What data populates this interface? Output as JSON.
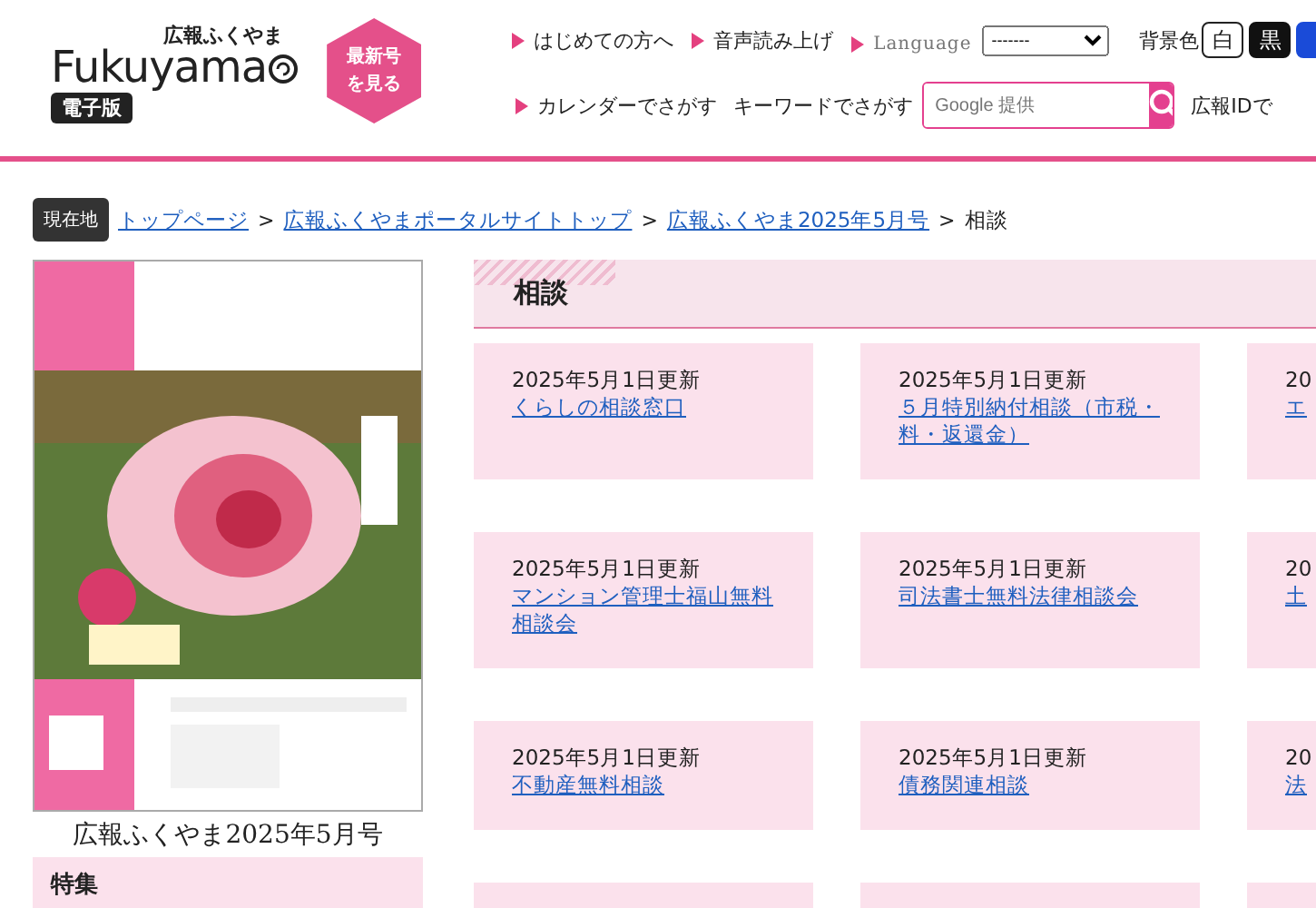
{
  "header": {
    "logo": {
      "title": "広報ふくやま",
      "wordmark": "Fukuyama",
      "badge": "電子版"
    },
    "latest_button": "最新号を見る",
    "links_row1": [
      "はじめての方へ",
      "音声読み上げ"
    ],
    "language": {
      "label": "Language",
      "value": "-------"
    },
    "background": {
      "label": "背景色",
      "options": [
        {
          "label": "白",
          "kind": "white"
        },
        {
          "label": "黒",
          "kind": "black"
        },
        {
          "kind": "blue"
        }
      ]
    },
    "links_row2": [
      "カレンダーでさがす"
    ],
    "search": {
      "label": "キーワードでさがす",
      "placeholder": "Google 提供"
    },
    "id_search": "広報IDで"
  },
  "breadcrumb": {
    "label": "現在地",
    "links": [
      {
        "label": "トップページ",
        "separator": ">"
      },
      {
        "label": "広報ふくやまポータルサイトトップ",
        "separator": ">"
      },
      {
        "label": "広報ふくやま2025年5月号",
        "separator": ">"
      }
    ],
    "current": "相談"
  },
  "sidebar": {
    "caption": "広報ふくやま2025年5月号",
    "section": "特集"
  },
  "main": {
    "heading": "相談",
    "cards": [
      {
        "kind": "article",
        "date": "2025年5月1日更新",
        "title": "くらしの相談窓口"
      },
      {
        "kind": "article",
        "date": "2025年5月1日更新",
        "title": "５月特別納付相談（市税・料・返還金）"
      },
      {
        "kind": "article",
        "date": "20",
        "title": "エ"
      },
      {
        "kind": "article",
        "date": "2025年5月1日更新",
        "title": "マンション管理士福山無料相談会"
      },
      {
        "kind": "article",
        "date": "2025年5月1日更新",
        "title": "司法書士無料法律相談会"
      },
      {
        "kind": "article",
        "date": "20",
        "title": "土"
      },
      {
        "kind": "article",
        "date": "2025年5月1日更新",
        "title": "不動産無料相談"
      },
      {
        "kind": "article",
        "date": "2025年5月1日更新",
        "title": "債務関連相談"
      },
      {
        "kind": "article",
        "date": "20",
        "title": "法"
      },
      {
        "kind": "blank"
      },
      {
        "kind": "blank"
      },
      {
        "kind": "blank"
      }
    ]
  }
}
